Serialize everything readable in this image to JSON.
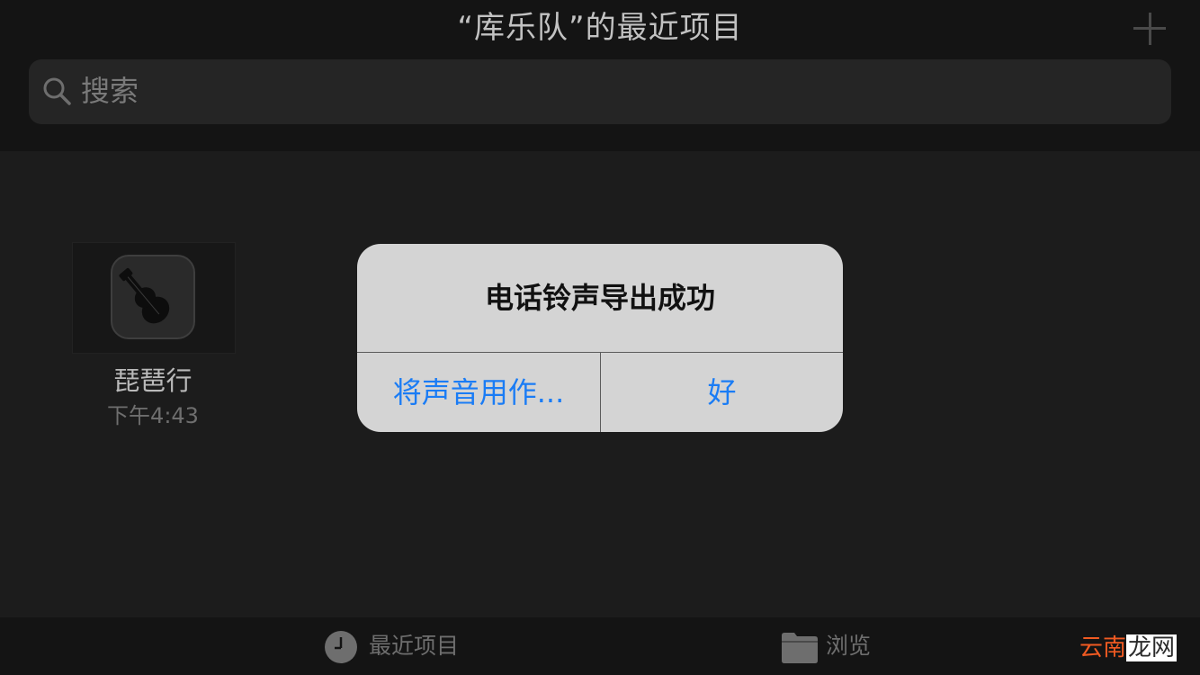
{
  "header": {
    "title": "“库乐队”的最近项目",
    "add_icon": "plus-icon"
  },
  "search": {
    "placeholder": "搜索",
    "icon": "search-icon"
  },
  "projects": [
    {
      "name": "琵琶行",
      "time": "下午4:43",
      "icon": "garageband-guitar-icon"
    }
  ],
  "alert": {
    "title": "电话铃声导出成功",
    "left_button": "将声音用作...",
    "right_button": "好",
    "button_color": "#1a7cf5"
  },
  "tabbar": {
    "recents_label": "最近项目",
    "recents_icon": "clock-icon",
    "browse_label": "浏览",
    "browse_icon": "folder-icon"
  },
  "watermark": {
    "part1": "云南",
    "part2": "龙网"
  }
}
